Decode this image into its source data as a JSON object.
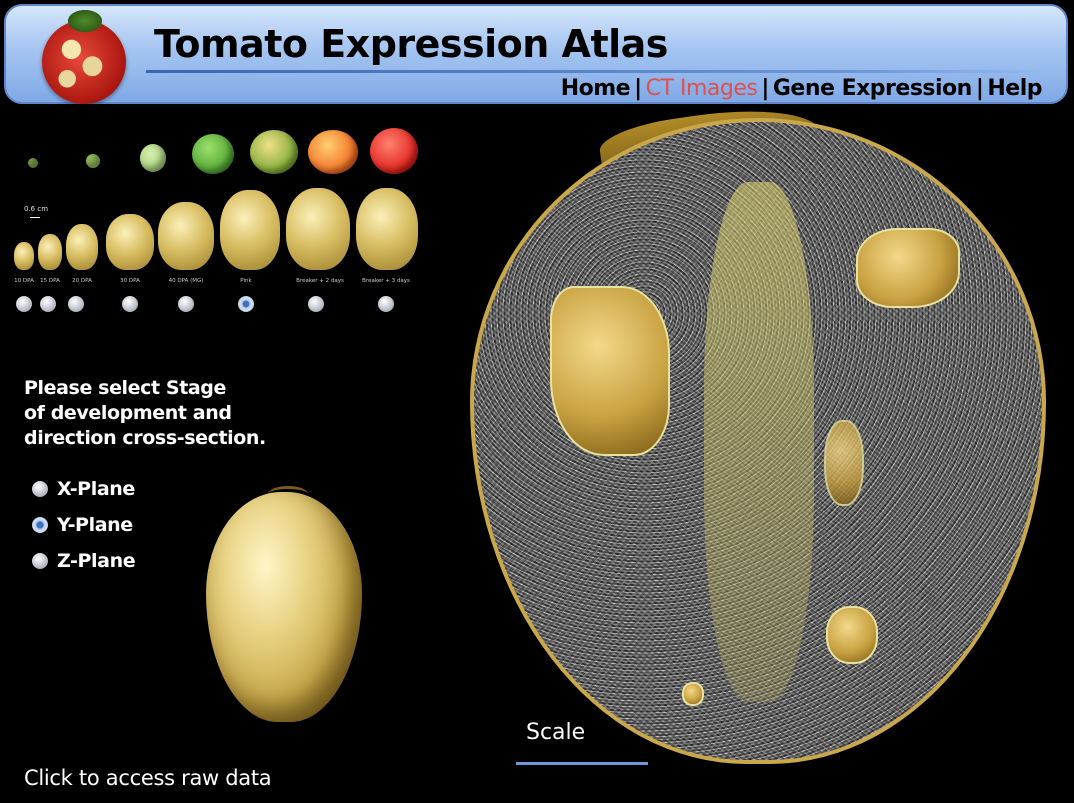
{
  "header": {
    "title": "Tomato Expression Atlas",
    "nav": [
      {
        "label": "Home",
        "active": false
      },
      {
        "label": "CT Images",
        "active": true
      },
      {
        "label": "Gene Expression",
        "active": false
      },
      {
        "label": "Help",
        "active": false
      }
    ],
    "nav_separator": "|",
    "accent_color": "#e0504a"
  },
  "stages": {
    "scale_label": "0.6 cm",
    "items": [
      {
        "label": "10 DPA",
        "selected": false
      },
      {
        "label": "15 DPA",
        "selected": false
      },
      {
        "label": "20 DPA",
        "selected": false
      },
      {
        "label": "30 DPA",
        "selected": false
      },
      {
        "label": "40 DPA  (MG)",
        "selected": false
      },
      {
        "label": "Pink",
        "selected": true
      },
      {
        "label": "Breaker + 2 days",
        "selected": false
      },
      {
        "label": "Breaker + 3 days",
        "selected": false
      }
    ]
  },
  "instructions": {
    "line1": "Please select Stage",
    "line2": "of development and",
    "line3": "direction cross-section."
  },
  "planes": [
    {
      "label": "X-Plane",
      "selected": false
    },
    {
      "label": "Y-Plane",
      "selected": true
    },
    {
      "label": "Z-Plane",
      "selected": false
    }
  ],
  "scale": {
    "label": "Scale"
  },
  "raw_data_link": "Click to access raw data"
}
